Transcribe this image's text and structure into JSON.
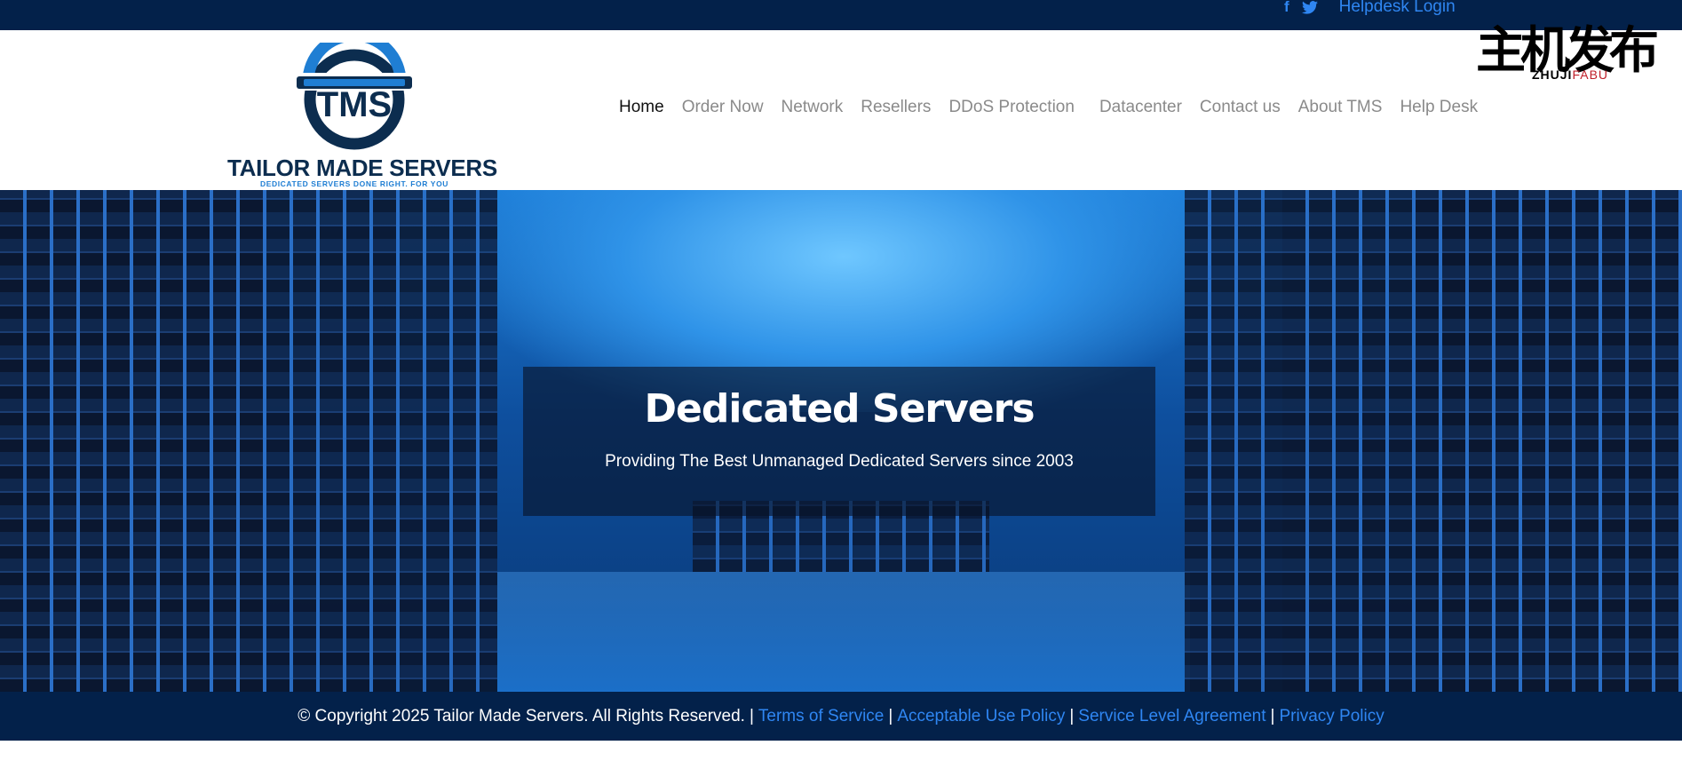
{
  "topbar": {
    "facebook_icon": "f",
    "helpdesk_login": "Helpdesk Login"
  },
  "logo": {
    "emblem_text": "TMS",
    "brand": "TAILOR MADE SERVERS",
    "tagline": "DEDICATED SERVERS DONE RIGHT. FOR YOU"
  },
  "nav": {
    "items": [
      {
        "label": "Home",
        "active": true
      },
      {
        "label": "Order Now"
      },
      {
        "label": "Network"
      },
      {
        "label": "Resellers"
      },
      {
        "label": "DDoS Protection"
      },
      {
        "label": "Datacenter"
      },
      {
        "label": "Contact us"
      },
      {
        "label": "About TMS"
      },
      {
        "label": "Help Desk"
      }
    ]
  },
  "watermark": {
    "chinese": "主机发布",
    "pinyin_a": "ZHUJI",
    "pinyin_b": "FABU"
  },
  "hero": {
    "title": "Dedicated Servers",
    "subtitle": "Providing The Best Unmanaged Dedicated Servers since 2003"
  },
  "footer": {
    "copyright": "© Copyright 2025 Tailor Made Servers. All Rights Reserved.",
    "separator": "|",
    "links": [
      "Terms of Service",
      "Acceptable Use Policy",
      "Service Level Agreement",
      "Privacy Policy"
    ]
  },
  "colors": {
    "navy": "#03214a",
    "link_blue": "#2f86f2",
    "logo_blue": "#1f7ed3",
    "logo_dark": "#0c2d4f",
    "nav_gray": "#8a8a8a"
  },
  "icons": [
    "facebook-icon",
    "twitter-icon",
    "tms-logo-emblem"
  ]
}
